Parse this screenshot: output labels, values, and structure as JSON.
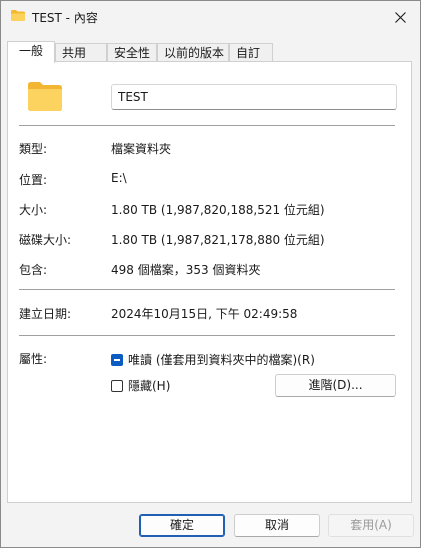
{
  "window": {
    "title": "TEST - 內容"
  },
  "tabs": [
    {
      "label": "一般",
      "active": true
    },
    {
      "label": "共用",
      "active": false
    },
    {
      "label": "安全性",
      "active": false
    },
    {
      "label": "以前的版本",
      "active": false
    },
    {
      "label": "自訂",
      "active": false
    }
  ],
  "general": {
    "name_value": "TEST",
    "type_label": "類型:",
    "type_value": "檔案資料夾",
    "location_label": "位置:",
    "location_value": "E:\\",
    "size_label": "大小:",
    "size_value": "1.80 TB (1,987,820,188,521 位元組)",
    "disk_size_label": "磁碟大小:",
    "disk_size_value": "1.80 TB (1,987,821,178,880 位元組)",
    "contains_label": "包含:",
    "contains_value": "498 個檔案，353 個資料夾",
    "created_label": "建立日期:",
    "created_value": "2024年10月15日, 下午 02:49:58",
    "attributes_label": "屬性:",
    "readonly_label": "唯讀 (僅套用到資料夾中的檔案)(R)",
    "hidden_label": "隱藏(H)",
    "advanced_button": "進階(D)..."
  },
  "buttons": {
    "ok": "確定",
    "cancel": "取消",
    "apply": "套用(A)"
  },
  "colors": {
    "folder": "#f7c948",
    "accent": "#0a5cc2"
  }
}
